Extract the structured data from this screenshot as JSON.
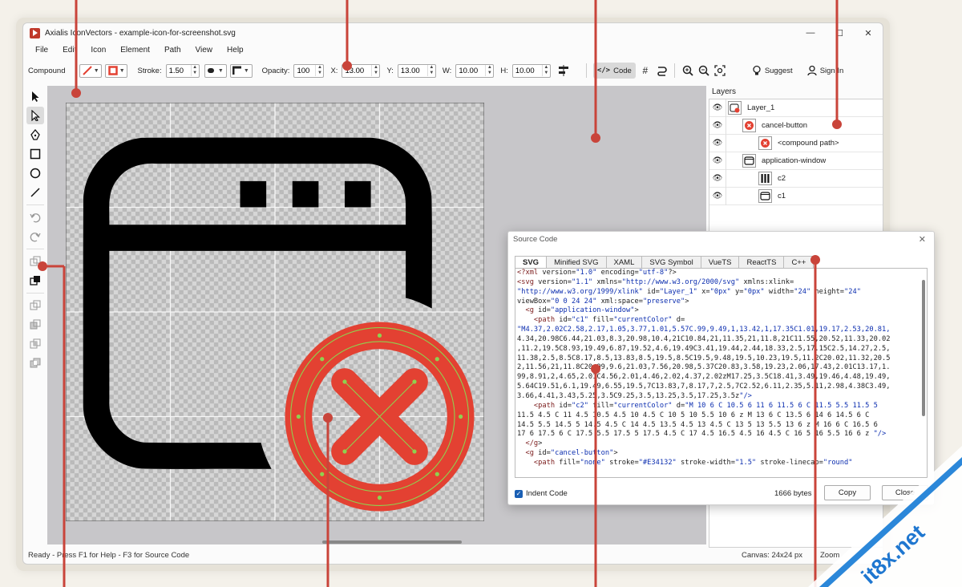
{
  "app": {
    "title": "Axialis IconVectors - example-icon-for-screenshot.svg",
    "window_controls": [
      "—",
      "☐",
      "✕"
    ]
  },
  "menu": [
    "File",
    "Edit",
    "Icon",
    "Element",
    "Path",
    "View",
    "Help"
  ],
  "toolbar": {
    "mode_label": "Compound",
    "stroke_label": "Stroke:",
    "stroke_value": "1.50",
    "opacity_label": "Opacity:",
    "opacity_value": "100",
    "x_label": "X:",
    "x_value": "13.00",
    "y_label": "Y:",
    "y_value": "13.00",
    "w_label": "W:",
    "w_value": "10.00",
    "h_label": "H:",
    "h_value": "10.00",
    "code_label": "Code",
    "suggest_label": "Suggest",
    "signin_label": "Sign In",
    "stroke_color": "#E34132",
    "fill_color": "#E34132"
  },
  "left_tools": [
    "select-arrow-icon",
    "direct-select-icon",
    "pen-icon",
    "rectangle-icon",
    "ellipse-icon",
    "line-icon",
    "undo-icon",
    "redo-icon",
    "combine-icon",
    "combine-active-icon",
    "boolean-union-icon",
    "boolean-subtract-icon",
    "boolean-intersect-icon",
    "boolean-exclude-icon"
  ],
  "layers": {
    "title": "Layers",
    "items": [
      {
        "name": "Layer_1",
        "indent": 0
      },
      {
        "name": "cancel-button",
        "indent": 1
      },
      {
        "name": "<compound path>",
        "indent": 2
      },
      {
        "name": "application-window",
        "indent": 1
      },
      {
        "name": "c2",
        "indent": 2
      },
      {
        "name": "c1",
        "indent": 2
      }
    ]
  },
  "status": {
    "left": "Ready - Press F1 for Help - F3 for Source Code",
    "canvas": "Canvas: 24x24 px",
    "zoom": "Zoom"
  },
  "source_code": {
    "title": "Source Code",
    "tabs": [
      "SVG",
      "Minified SVG",
      "XAML",
      "SVG Symbol",
      "VueTS",
      "ReactTS",
      "C++"
    ],
    "active_tab": "SVG",
    "lines": [
      "<?xml version=\"1.0\" encoding=\"utf-8\"?>",
      "<svg version=\"1.1\" xmlns=\"http://www.w3.org/2000/svg\" xmlns:xlink=",
      "\"http://www.w3.org/1999/xlink\" id=\"Layer_1\" x=\"0px\" y=\"0px\" width=\"24\" height=\"24\"",
      "viewBox=\"0 0 24 24\" xml:space=\"preserve\">",
      "  <g id=\"application-window\">",
      "    <path id=\"c1\" fill=\"currentColor\" d=",
      "\"M4.37,2.02C2.58,2.17,1.05,3.77,1.01,5.57C.99,9.49,1,13.42,1,17.35C1.01,19.17,2.53,20.81,",
      "4.34,20.98C6.44,21.03,8.3,20.98,10.4,21C10.84,21,11.35,21,11.8,21C11.55,20.52,11.33,20.02",
      ",11.2,19.5C8.93,19.49,6.87,19.52,4.6,19.49C3.41,19.44,2.44,18.33,2.5,17.15C2.5,14.27,2.5,",
      "11.38,2.5,8.5C8.17,8.5,13.83,8.5,19.5,8.5C19.5,9.48,19.5,10.23,19.5,11.2C20.02,11.32,20.5",
      "2,11.56,21,11.8C20.99,9.6,21.03,7.56,20.98,5.37C20.83,3.58,19.23,2.06,17.43,2.01C13.17,1.",
      "99,8.91,2,4.65,2.01C4.56,2.01,4.46,2.02,4.37,2.02zM17.25,3.5C18.41,3.49,19.46,4.48,19.49,",
      "5.64C19.51,6.1,19.49,6.55,19.5,7C13.83,7,8.17,7,2.5,7C2.52,6.11,2.35,5.11,2.98,4.38C3.49,",
      "3.66,4.41,3.43,5.25,3.5C9.25,3.5,13.25,3.5,17.25,3.5z\"/>",
      "    <path id=\"c2\" fill=\"currentColor\" d=\"M 10 6 C 10.5 6 11 6 11.5 6 C 11.5 5.5 11.5 5",
      "11.5 4.5 C 11 4.5 10.5 4.5 10 4.5 C 10 5 10 5.5 10 6 z M 13 6 C 13.5 6 14 6 14.5 6 C",
      "14.5 5.5 14.5 5 14.5 4.5 C 14 4.5 13.5 4.5 13 4.5 C 13 5 13 5.5 13 6 z M 16 6 C 16.5 6",
      "17 6 17.5 6 C 17.5 5.5 17.5 5 17.5 4.5 C 17 4.5 16.5 4.5 16 4.5 C 16 5 16 5.5 16 6 z \"/>",
      "  </g>",
      "  <g id=\"cancel-button\">",
      "    <path fill=\"none\" stroke=\"#E34132\" stroke-width=\"1.5\" stroke-linecap=\"round\""
    ],
    "indent_label": "Indent Code",
    "bytes": "1666 bytes",
    "copy_label": "Copy",
    "close_label": "Close"
  },
  "watermark": "it8x.net",
  "colors": {
    "accent_red": "#E34132",
    "callout_red": "#C9443A",
    "watermark_blue": "#1F77D0"
  }
}
